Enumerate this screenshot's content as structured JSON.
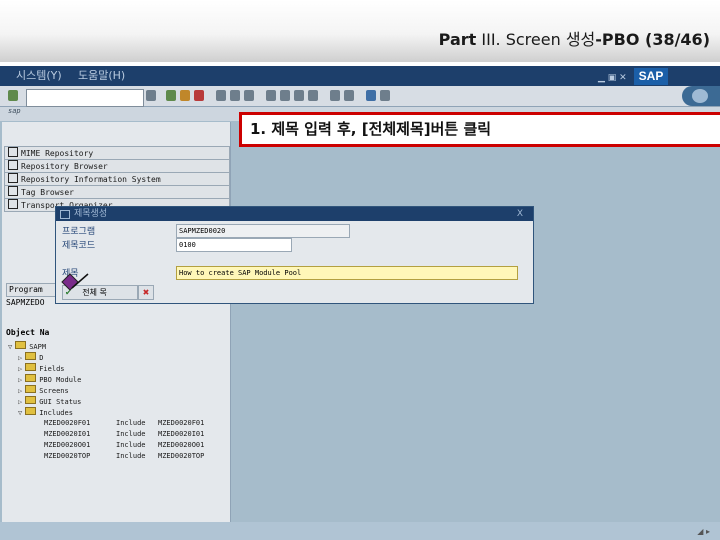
{
  "slide": {
    "title_bold": "Part",
    "title_rest": " III. Screen 생성",
    "title_bold2": "-PBO (38/46)"
  },
  "menu": {
    "items": [
      "시스템(Y)",
      "도움말(H)"
    ]
  },
  "toolbar": {
    "command_value": "",
    "logo_text": "SAP"
  },
  "nav": {
    "buttons": [
      "MIME Repository",
      "Repository Browser",
      "Repository Information System",
      "Tag Browser",
      "Transport Organizer"
    ],
    "program_label": "Program",
    "program_value": "SAPMZEDO",
    "object_header": "Object Na"
  },
  "tree": {
    "root": "SAPM",
    "folders": [
      "D",
      "Fields",
      "PBO Module",
      "Screens",
      "GUI Status",
      "Includes"
    ],
    "includes": [
      {
        "name": "MZED0020F01",
        "type": "Include",
        "obj": "MZED0020F01"
      },
      {
        "name": "MZED0020I01",
        "type": "Include",
        "obj": "MZED0020I01"
      },
      {
        "name": "MZED0020O01",
        "type": "Include",
        "obj": "MZED0020O01"
      },
      {
        "name": "MZED0020TOP",
        "type": "Include",
        "obj": "MZED0020TOP"
      }
    ]
  },
  "dialog": {
    "title": "제목생성",
    "close": "X",
    "program_label": "프로그램",
    "program_value": "SAPMZED0020",
    "code_label": "제목코드",
    "code_value": "0100",
    "title_label": "제목",
    "title_value": "How to create SAP Module Pool",
    "all_titles_label": "전체 목",
    "cancel_label": "✖"
  },
  "callout": {
    "text": "1. 제목 입력 후, [전체제목]버튼 클릭"
  },
  "colors": {
    "gui_bg": "#a6bccb",
    "menubar": "#1d3f6b",
    "callout_border": "#cc0000",
    "edit_field": "#fff7b8"
  }
}
